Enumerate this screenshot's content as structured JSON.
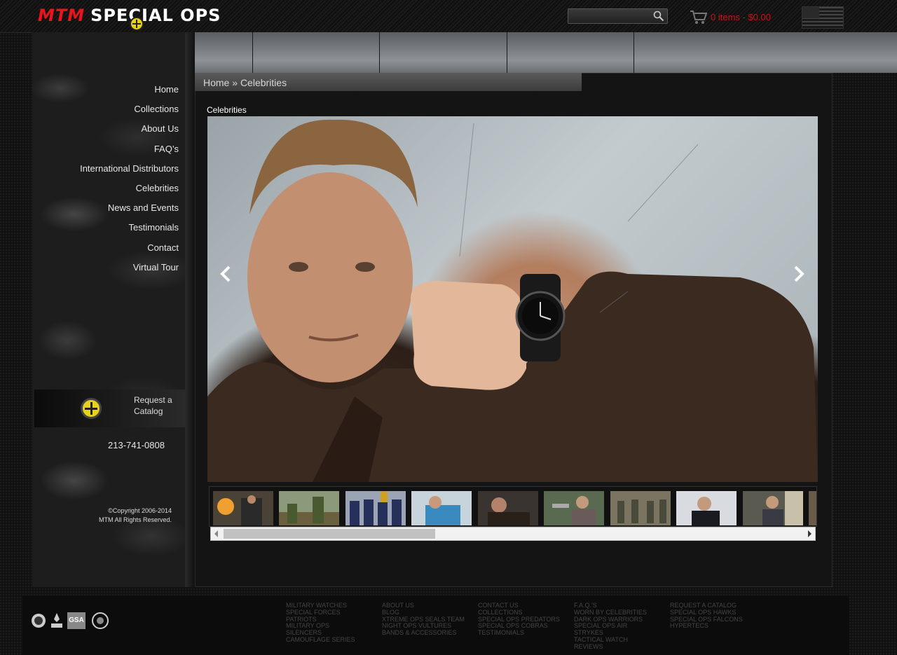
{
  "header": {
    "logo_mtm": "MTM",
    "logo_ops": "SPECIAL OPS",
    "search_placeholder": "",
    "cart_text": "0 items - $0.00"
  },
  "sidebar": {
    "nav": [
      "Home",
      "Collections",
      "About Us",
      "FAQ’s",
      "International Distributors",
      "Celebrities",
      "News and Events",
      "Testimonials",
      "Contact",
      "Virtual Tour"
    ],
    "catalog_line1": "Request a",
    "catalog_line2": "Catalog",
    "phone": "213-741-0808",
    "copyright_line1": "©Copyright 2006-2014",
    "copyright_line2": "MTM All Rights Reserved."
  },
  "main": {
    "breadcrumb_home": "Home",
    "breadcrumb_sep": "»",
    "breadcrumb_current": "Celebrities",
    "page_title": "Celebrities"
  },
  "footer": {
    "seal_labels": [
      "GSA"
    ],
    "col1": [
      "MILITARY WATCHES",
      "SPECIAL FORCES",
      "PATRIOTS",
      "MILITARY OPS",
      "SILENCERS",
      "CAMOUFLAGE SERIES"
    ],
    "col2": [
      "ABOUT US",
      "BLOG",
      "XTREME OPS SEALS TEAM",
      "NIGHT OPS VULTURES",
      "BANDS & ACCESSORIES"
    ],
    "col3": [
      "CONTACT US",
      "COLLECTIONS",
      "SPECIAL OPS PREDATORS",
      "SPECIAL OPS COBRAS",
      "TESTIMONIALS"
    ],
    "col4": [
      "F.A.Q.'S",
      "WORN BY CELEBRITIES",
      "DARK OPS WARRIORS",
      "SPECIAL OPS AIR",
      "STRYKES",
      "TACTICAL WATCH",
      "REVIEWS"
    ],
    "col5": [
      "REQUEST A CATALOG",
      "SPECIAL OPS HAWKS",
      "SPECIAL OPS FALCONS",
      "HYPERTECS"
    ]
  },
  "colors": {
    "brand_red": "#e8161b",
    "cart_red": "#c41616",
    "badge_yellow": "#e6d21a"
  }
}
